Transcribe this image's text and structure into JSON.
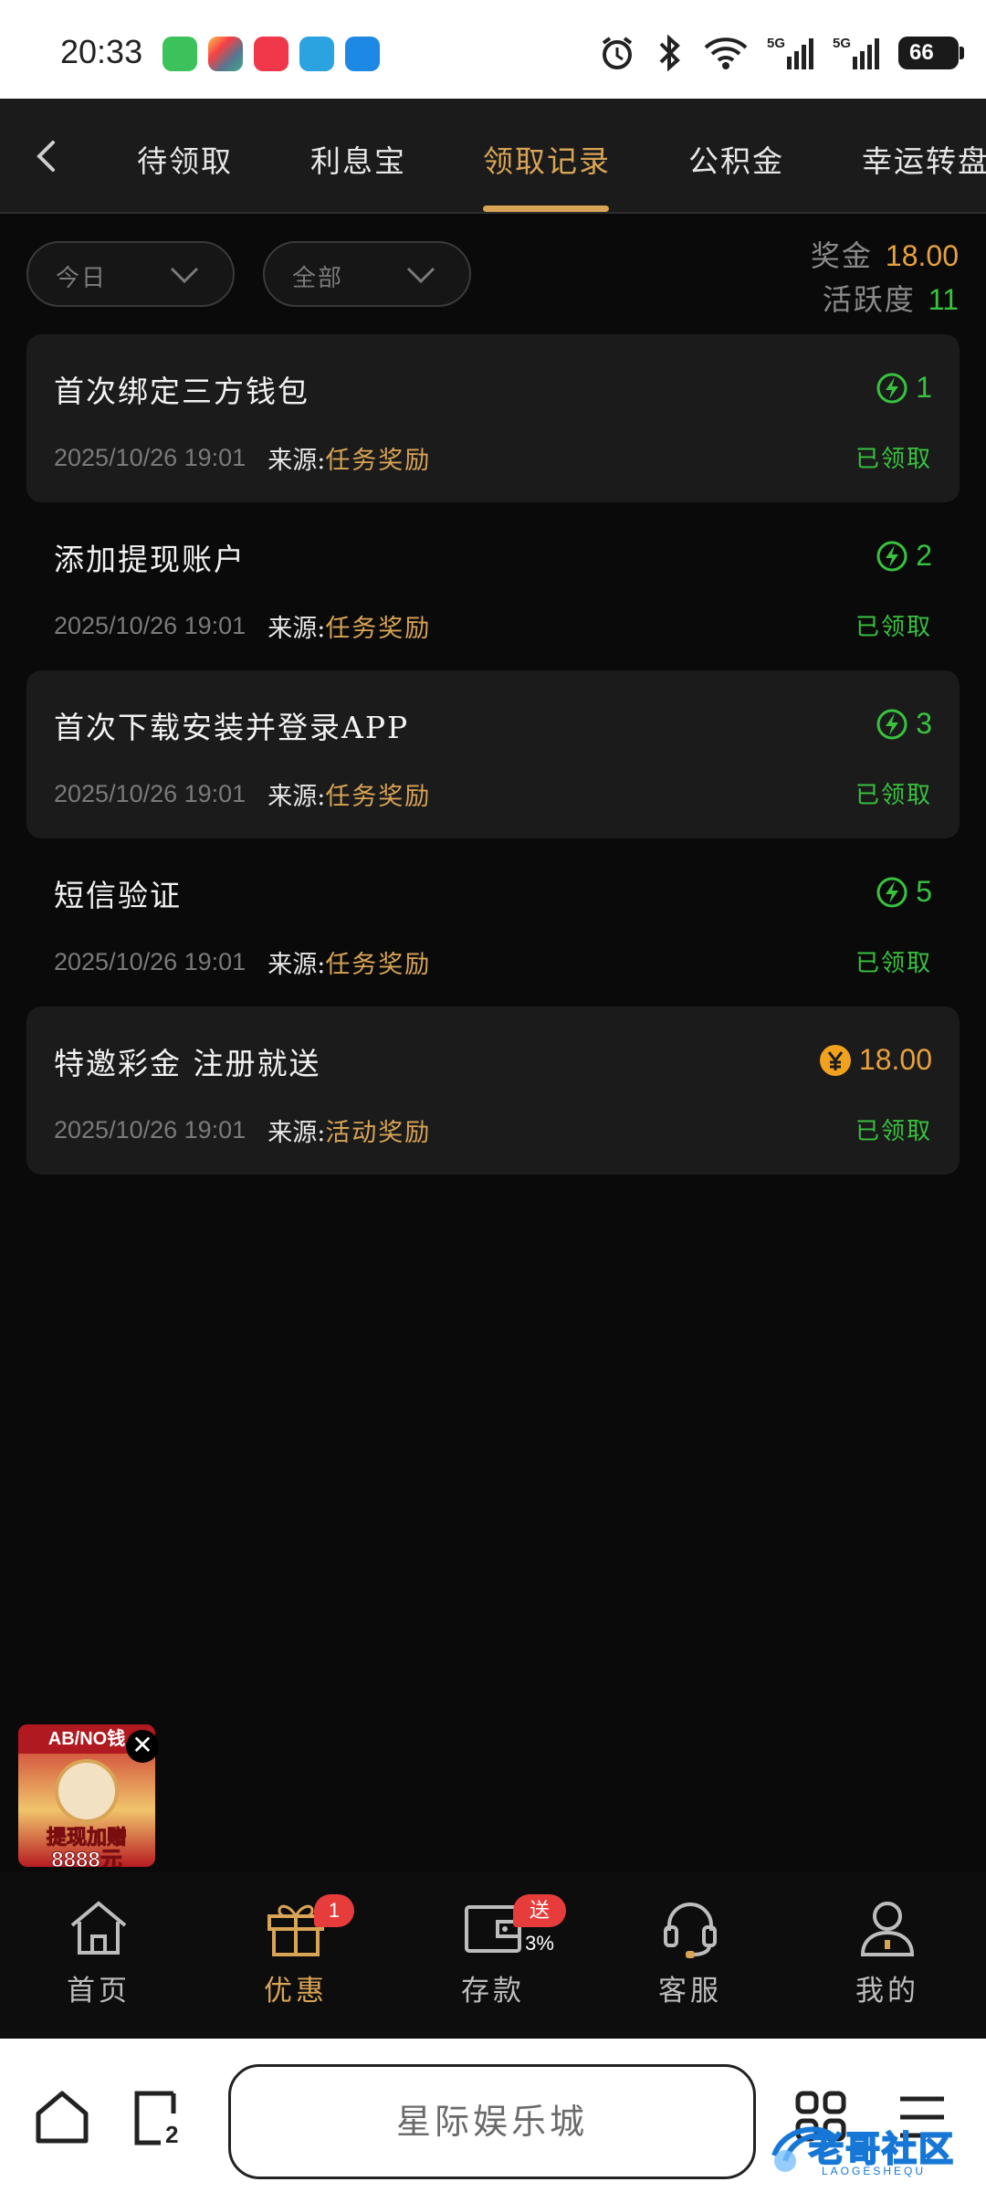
{
  "status_bar": {
    "time": "20:33",
    "battery": "66",
    "network_1": "5G",
    "network_2": "5G"
  },
  "tabs": [
    {
      "label": "待领取"
    },
    {
      "label": "利息宝"
    },
    {
      "label": "领取记录",
      "active": true
    },
    {
      "label": "公积金"
    },
    {
      "label": "幸运转盘"
    }
  ],
  "filters": {
    "date": "今日",
    "type": "全部"
  },
  "summary": {
    "bonus_label": "奖金",
    "bonus_value": "18.00",
    "activity_label": "活跃度",
    "activity_value": "11"
  },
  "records": [
    {
      "title": "首次绑定三方钱包",
      "time": "2025/10/26 19:01",
      "source_label": "来源:",
      "source": "任务奖励",
      "reward_icon": "lightning-icon",
      "reward": "1",
      "status": "已领取"
    },
    {
      "title": "添加提现账户",
      "time": "2025/10/26 19:01",
      "source_label": "来源:",
      "source": "任务奖励",
      "reward_icon": "lightning-icon",
      "reward": "2",
      "status": "已领取"
    },
    {
      "title": "首次下载安装并登录APP",
      "time": "2025/10/26 19:01",
      "source_label": "来源:",
      "source": "任务奖励",
      "reward_icon": "lightning-icon",
      "reward": "3",
      "status": "已领取"
    },
    {
      "title": "短信验证",
      "time": "2025/10/26 19:01",
      "source_label": "来源:",
      "source": "任务奖励",
      "reward_icon": "lightning-icon",
      "reward": "5",
      "status": "已领取"
    },
    {
      "title": "特邀彩金 注册就送",
      "time": "2025/10/26 19:01",
      "source_label": "来源:",
      "source": "活动奖励",
      "reward_icon": "yuan-coin-icon",
      "reward": "18.00",
      "status": "已领取"
    }
  ],
  "promo": {
    "top_text": "AB/NO钱",
    "line1": "提现加赠",
    "line2": "8888元",
    "close": "✕"
  },
  "bottom_nav": [
    {
      "label": "首页",
      "icon": "home-icon"
    },
    {
      "label": "优惠",
      "icon": "gift-icon",
      "badge": "1",
      "active": true
    },
    {
      "label": "存款",
      "icon": "wallet-icon",
      "badge": "送3%"
    },
    {
      "label": "客服",
      "icon": "headset-icon"
    },
    {
      "label": "我的",
      "icon": "user-icon"
    }
  ],
  "browser": {
    "title": "星际娱乐城",
    "tabs_count": "2"
  },
  "watermark": {
    "text": "老哥社区",
    "sub": "LAOGESHEQU"
  },
  "colors": {
    "accent_gold": "#d8a456",
    "reward_green": "#38c23e",
    "bonus_orange": "#e8a13c",
    "background": "#0a0a0a",
    "card_bg": "#1b1b1b"
  }
}
